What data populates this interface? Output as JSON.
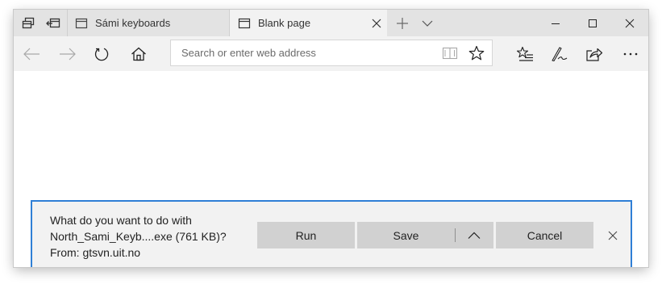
{
  "tabs": [
    {
      "label": "Sámi keyboards",
      "active": false
    },
    {
      "label": "Blank page",
      "active": true
    }
  ],
  "addressbar": {
    "placeholder": "Search or enter web address",
    "value": ""
  },
  "download": {
    "line1": "What do you want to do with",
    "line2": "North_Sami_Keyb....exe (761 KB)?",
    "line3": "From: gtsvn.uit.no",
    "run_label": "Run",
    "save_label": "Save",
    "cancel_label": "Cancel"
  },
  "colors": {
    "accent": "#2f7fd6",
    "tabstrip": "#e3e3e3",
    "toolbar": "#f2f2f2",
    "button": "#d1d1d1"
  },
  "icons": {
    "tab_strip": [
      "tab-preview-icon",
      "set-aside-tabs-icon"
    ],
    "toolbar": [
      "back-arrow-icon",
      "forward-arrow-icon",
      "refresh-icon",
      "home-icon",
      "reading-view-icon",
      "favorite-star-icon",
      "favorites-hub-icon",
      "web-note-icon",
      "share-icon",
      "more-icon"
    ],
    "window": [
      "minimize-icon",
      "maximize-icon",
      "close-icon"
    ]
  }
}
